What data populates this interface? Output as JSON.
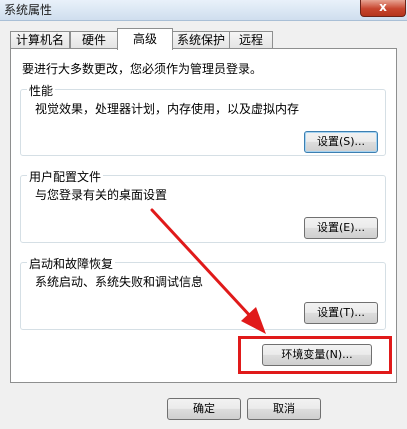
{
  "window": {
    "title": "系统属性",
    "close_label": "x"
  },
  "tabs": [
    {
      "label": "计算机名"
    },
    {
      "label": "硬件"
    },
    {
      "label": "高级"
    },
    {
      "label": "系统保护"
    },
    {
      "label": "远程"
    }
  ],
  "active_tab": "高级",
  "main": {
    "note": "要进行大多数更改，您必须作为管理员登录。",
    "performance": {
      "title": "性能",
      "description": "视觉效果，处理器计划，内存使用，以及虚拟内存",
      "button": "设置(S)..."
    },
    "user_profiles": {
      "title": "用户配置文件",
      "description": "与您登录有关的桌面设置",
      "button": "设置(E)..."
    },
    "startup_recovery": {
      "title": "启动和故障恢复",
      "description": "系统启动、系统失败和调试信息",
      "button": "设置(T)..."
    },
    "env_vars_button": "环境变量(N)..."
  },
  "footer": {
    "ok_label": "确定",
    "cancel_label": "取消"
  },
  "annotation": {
    "color": "#e01a1a"
  }
}
